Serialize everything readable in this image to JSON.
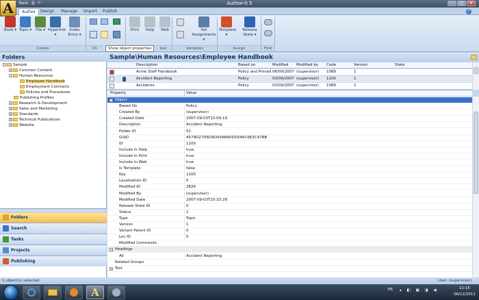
{
  "app": {
    "title": "Author-it 5"
  },
  "quick_access": {
    "back": "Back",
    "print": "⎙",
    "undo": "↶"
  },
  "window_controls": {
    "minimize": "–",
    "maximize": "□",
    "close": "✕"
  },
  "tabs": [
    "Author",
    "Design",
    "Manage",
    "Import",
    "Publish"
  ],
  "ribbon": {
    "buttons": [
      {
        "label": "Book ▾",
        "icon": "book-icon",
        "color": "#c0392b"
      },
      {
        "label": "Topic ▾",
        "icon": "topic-icon",
        "color": "#3f7cc4"
      },
      {
        "label": "File ▾",
        "icon": "file-icon",
        "color": "#5a8a3a"
      },
      {
        "label": "Hyperlink ▾",
        "icon": "hyperlink-icon",
        "color": "#3b6ea8"
      },
      {
        "label": "Index Entry ▾",
        "icon": "index-icon",
        "color": "#6f8fb8"
      },
      {
        "label": "Print",
        "icon": "print-icon",
        "color": "#b8c0cc"
      },
      {
        "label": "Help",
        "icon": "help-icon",
        "color": "#b8c0cc"
      },
      {
        "label": "Web",
        "icon": "web-icon",
        "color": "#b8c0cc"
      },
      {
        "label": "Set Assignments ▾",
        "icon": "assignments-icon",
        "color": "#5c7fa6"
      },
      {
        "label": "Template ▾",
        "icon": "template-icon",
        "color": "#d04f2a"
      },
      {
        "label": "Release State ▾",
        "icon": "release-state-icon",
        "color": "#2c64b3"
      }
    ],
    "groups": [
      "Create",
      "Sh",
      "iew",
      "Variables",
      "Assign",
      "Find"
    ],
    "tooltip": "Show object properties"
  },
  "folders": {
    "title": "Folders",
    "tree": [
      {
        "label": "Sample",
        "level": 0,
        "exp": "−"
      },
      {
        "label": "Common Content",
        "level": 1,
        "exp": "+"
      },
      {
        "label": "Human Resources",
        "level": 1,
        "exp": "−"
      },
      {
        "label": "Employee Handbook",
        "level": 2,
        "exp": "",
        "selected": true
      },
      {
        "label": "Employment Contracts",
        "level": 2,
        "exp": ""
      },
      {
        "label": "Policies and Procedures",
        "level": 2,
        "exp": ""
      },
      {
        "label": "Publishing Profiles",
        "level": 1,
        "exp": ""
      },
      {
        "label": "Research & Development",
        "level": 1,
        "exp": "+"
      },
      {
        "label": "Sales and Marketing",
        "level": 1,
        "exp": "+"
      },
      {
        "label": "Standards",
        "level": 1,
        "exp": "+"
      },
      {
        "label": "Technical Publications",
        "level": 1,
        "exp": "+"
      },
      {
        "label": "Website",
        "level": 1,
        "exp": "+"
      }
    ]
  },
  "nav_buttons": [
    {
      "label": "Folders",
      "color": "#e2a32e"
    },
    {
      "label": "Search",
      "color": "#3a74c4"
    },
    {
      "label": "Tasks",
      "color": "#3d9b3d"
    },
    {
      "label": "Projects",
      "color": "#5b8ad1"
    },
    {
      "label": "Publishing",
      "color": "#d45b2c"
    }
  ],
  "breadcrumb": "Sample\\Human Resources\\Employee Handbook",
  "list": {
    "columns": [
      "Description",
      "Based on",
      "Modified",
      "Modified by",
      "Code",
      "Version",
      "State"
    ],
    "rows": [
      {
        "description": "Acme Staff Handbook",
        "based_on": "Policy and Procedure",
        "modified": "06/09/2007",
        "modified_by": "(supervisor)",
        "code": "1089",
        "version": "1",
        "state": ""
      },
      {
        "description": "Accident Reporting",
        "based_on": "Policy",
        "modified": "03/09/2007",
        "modified_by": "(supervisor)",
        "code": "1100",
        "version": "1",
        "state": ""
      },
      {
        "description": "Accidents",
        "based_on": "Policy",
        "modified": "03/09/2007",
        "modified_by": "(supervisor)",
        "code": "1089",
        "version": "1",
        "state": ""
      }
    ]
  },
  "properties": {
    "columns": [
      "Property",
      "Value"
    ],
    "rows": [
      {
        "name": "Object",
        "value": "",
        "type": "category-active",
        "exp": "−"
      },
      {
        "name": "Based On",
        "value": "Policy"
      },
      {
        "name": "Created By",
        "value": "(supervisor)"
      },
      {
        "name": "Created Date",
        "value": "2007-09-03T10:09:19"
      },
      {
        "name": "Description",
        "value": "Accident Reporting"
      },
      {
        "name": "Folder ID",
        "value": "52"
      },
      {
        "name": "GUID",
        "value": "4579D27D6D9D439BA0DD546C6E3C47BB"
      },
      {
        "name": "ID",
        "value": "1100"
      },
      {
        "name": "Include In Help",
        "value": "true"
      },
      {
        "name": "Include In Print",
        "value": "true"
      },
      {
        "name": "Include In Web",
        "value": "true"
      },
      {
        "name": "Is Template",
        "value": "false"
      },
      {
        "name": "Key",
        "value": "1100"
      },
      {
        "name": "Localization ID",
        "value": "0"
      },
      {
        "name": "Modified ID",
        "value": "2826"
      },
      {
        "name": "Modified By",
        "value": "(supervisor)"
      },
      {
        "name": "Modified Date",
        "value": "2007-09-03T10:33:28"
      },
      {
        "name": "Release State ID",
        "value": "0"
      },
      {
        "name": "Status",
        "value": "1"
      },
      {
        "name": "Type",
        "value": "Topic"
      },
      {
        "name": "Version",
        "value": "1"
      },
      {
        "name": "Variant Parent ID",
        "value": "0"
      },
      {
        "name": "Loc ID",
        "value": "0"
      },
      {
        "name": "Modified Comments",
        "value": ""
      },
      {
        "name": "Headings",
        "value": "",
        "type": "category",
        "exp": "−"
      },
      {
        "name": "All",
        "value": "Accident Reporting"
      },
      {
        "name": "Related Groups",
        "value": "",
        "type": "sub"
      },
      {
        "name": "Test",
        "value": "",
        "type": "sub",
        "exp": "+"
      }
    ]
  },
  "status": {
    "left": "1 object(s) selected",
    "right": "User: (supervisor)"
  },
  "taskbar": {
    "lang": "FR",
    "time": "11:15",
    "date": "06/12/2011"
  }
}
